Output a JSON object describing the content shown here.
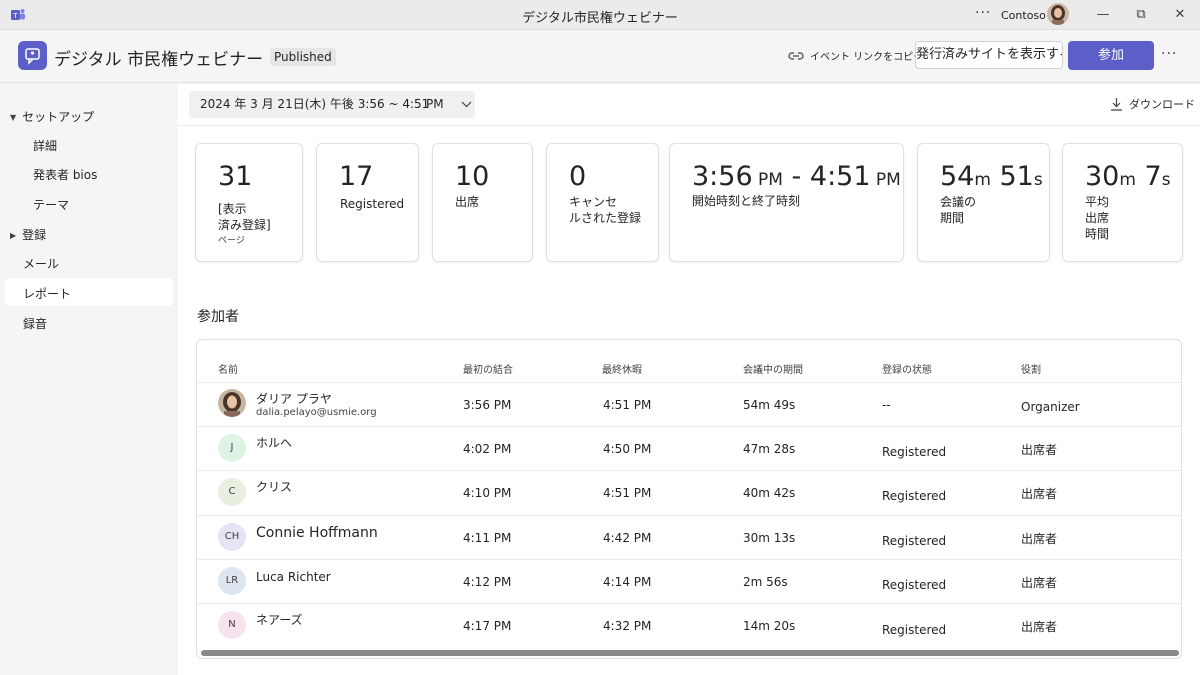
{
  "window": {
    "title": "デジタル市民権ウェビナー",
    "more_label": "···",
    "org": "Contoso",
    "minimize": "—",
    "restore": "⧉",
    "close": "✕"
  },
  "header": {
    "event_title": "デジタル 市民権ウェビナー",
    "status_badge": "Published",
    "copy_link_label": "イベント リンクをコピーする",
    "view_site_label": "発行済みサイトを表示する",
    "join_label": "参加",
    "more_label": "···",
    "accent_color": "#5b5fc7"
  },
  "sidebar": {
    "items": [
      {
        "label": "セットアップ",
        "expanded": true
      },
      {
        "label": "詳細"
      },
      {
        "label": "発表者 bios"
      },
      {
        "label": "テーマ"
      },
      {
        "label": "登録",
        "expanded": false
      },
      {
        "label": "メール"
      },
      {
        "label": "レポート",
        "active": true
      },
      {
        "label": "録音"
      }
    ]
  },
  "toolbar": {
    "date_range": "2024 年 3 月 21日(木) 午後 3:56 ~ 4:51",
    "date_suffix": "PM",
    "download_label": "ダウンロード"
  },
  "stats": [
    {
      "value": "31",
      "label": "[表示\n済み登録]",
      "sub": "ページ"
    },
    {
      "value": "17",
      "label": "Registered"
    },
    {
      "value": "10",
      "label": "出席"
    },
    {
      "value": "0",
      "label": "キャンセ\nルされた登録"
    },
    {
      "value_a": "3:56",
      "unit_a": " PM",
      "sep": " - ",
      "value_b": "4:51",
      "unit_b": " PM",
      "label": "開始時刻と終了時刻"
    },
    {
      "value_a": "54",
      "unit_a": "m",
      "value_b": " 51",
      "unit_b": "s",
      "label": "会議の\n期間"
    },
    {
      "value_a": "30",
      "unit_a": "m",
      "value_b": " 7",
      "unit_b": "s",
      "label": "平均\n出席\n時間"
    }
  ],
  "attendees": {
    "section_title": "参加者",
    "columns": [
      "名前",
      "最初の結合",
      "最終休暇",
      "会議中の期間",
      "登録の状態",
      "役割"
    ],
    "rows": [
      {
        "name": "ダリア プラヤ",
        "email": "dalia.pelayo@usmie.org",
        "initials": "",
        "first_join": "3:56 PM",
        "last_leave": "4:51 PM",
        "duration": "54m 49s",
        "reg_status": "--",
        "role": "Organizer"
      },
      {
        "name": "ホルヘ",
        "initials": "J",
        "avatar_color": "#dff3e4",
        "first_join": "4:02 PM",
        "last_leave": "4:50 PM",
        "duration": "47m 28s",
        "reg_status": "Registered",
        "role": "出席者"
      },
      {
        "name": "クリス",
        "initials": "C",
        "avatar_color": "#e6efe0",
        "first_join": "4:10 PM",
        "last_leave": "4:51 PM",
        "duration": "40m 42s",
        "reg_status": "Registered",
        "role": "出席者"
      },
      {
        "name": "Connie Hoffmann",
        "initials": "CH",
        "avatar_color": "#e5e4f5",
        "first_join": "4:11 PM",
        "last_leave": "4:42 PM",
        "duration": "30m 13s",
        "reg_status": "Registered",
        "role": "出席者"
      },
      {
        "name": "Luca Richter",
        "initials": "LR",
        "avatar_color": "#dde6ee",
        "first_join": "4:12 PM",
        "last_leave": "4:14 PM",
        "duration": "2m 56s",
        "reg_status": "Registered",
        "role": "出席者"
      },
      {
        "name": "ネアーズ",
        "initials": "N",
        "avatar_color": "#f6e3ef",
        "first_join": "4:17 PM",
        "last_leave": "4:32 PM",
        "duration": "14m 20s",
        "reg_status": "Registered",
        "role": "出席者"
      }
    ]
  }
}
